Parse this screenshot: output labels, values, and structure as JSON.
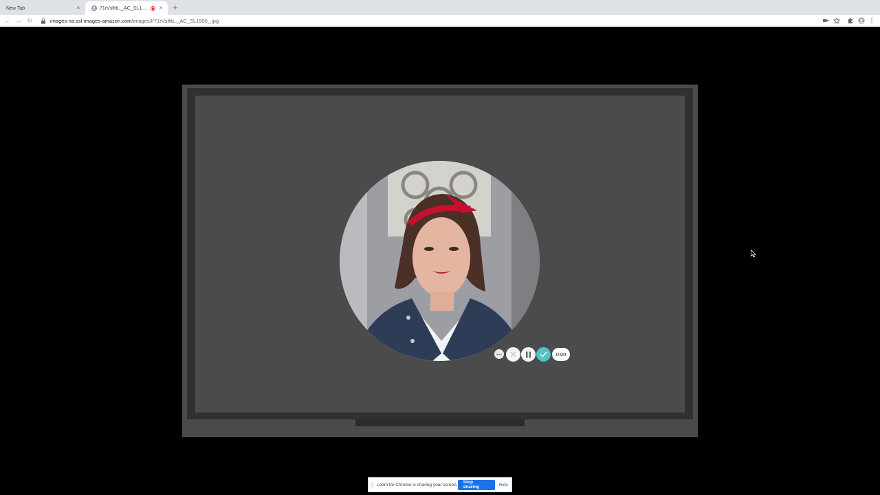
{
  "browser": {
    "tabs": [
      {
        "title": "New Tab",
        "active": false
      },
      {
        "title": "71rVslfitL._AC_SL1500_.jpg",
        "active": true,
        "recording": true
      }
    ],
    "new_tab_symbol": "+",
    "address_bar": {
      "domain": "images-na.ssl-images-amazon.com",
      "path": "/images/I/71rVslfitL._AC_SL1500_.jpg"
    },
    "toolbar_icons": [
      "back-icon",
      "forward-icon",
      "reload-icon",
      "lock-icon",
      "camera-icon",
      "star-icon",
      "extensions-icon",
      "profile-icon",
      "menu-icon"
    ]
  },
  "loom": {
    "controls": [
      {
        "name": "more-options-button",
        "icon": "ellipsis-icon"
      },
      {
        "name": "cancel-recording-button",
        "icon": "close-icon"
      },
      {
        "name": "pause-recording-button",
        "icon": "pause-icon"
      },
      {
        "name": "finish-recording-button",
        "icon": "check-icon"
      }
    ],
    "timer": "0:00",
    "colors": {
      "finish": "#4fc3c4",
      "share_button": "#1a73e8"
    }
  },
  "share_bar": {
    "message": "Loom for Chrome is sharing your screen.",
    "stop_label": "Stop sharing",
    "hide_label": "Hide"
  }
}
